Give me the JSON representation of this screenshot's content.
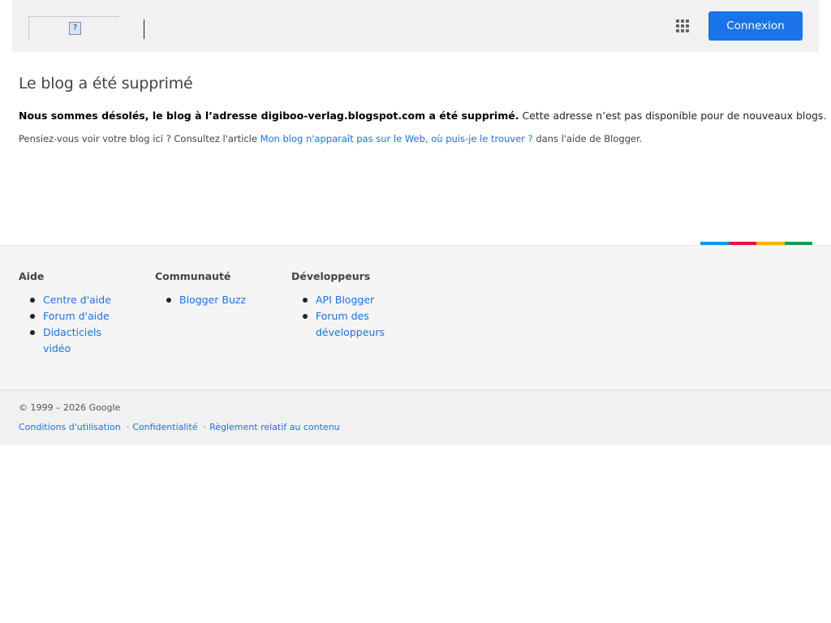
{
  "header": {
    "signin_label": "Connexion",
    "broken_image_glyph": "?"
  },
  "main": {
    "title": "Le blog a été supprimé",
    "line1_bold": "Nous sommes désolés, le blog à l’adresse digiboo-verlag.blogspot.com a été supprimé.",
    "line1_rest": "Cette adresse n’est pas disponible pour de nouveaux blogs.",
    "line2_before": "Pensiez-vous voir votre blog ici ? Consultez l'article",
    "line2_link": "Mon blog n'apparaît pas sur le Web, où puis-je le trouver ?",
    "line2_after": "dans l'aide de Blogger."
  },
  "strip_colors": [
    "#039be5",
    "#e41443",
    "#f4b400",
    "#0f9d58"
  ],
  "footer": {
    "columns": [
      {
        "title": "Aide",
        "items": [
          "Centre d'aide",
          "Forum d'aide",
          "Didacticiels vidéo"
        ]
      },
      {
        "title": "Communauté",
        "items": [
          "Blogger Buzz"
        ]
      },
      {
        "title": "Développeurs",
        "items": [
          "API Blogger",
          "Forum des développeurs"
        ]
      }
    ],
    "copyright": "© 1999 – 2026 Google",
    "legal": [
      "Conditions d'utilisation",
      "Confidentialité",
      "Règlement relatif au contenu"
    ],
    "legal_separator": "·"
  },
  "colors": {
    "accent": "#1a73e8",
    "header_bg": "#f1f1f1",
    "footer_bg": "#f5f5f5"
  }
}
